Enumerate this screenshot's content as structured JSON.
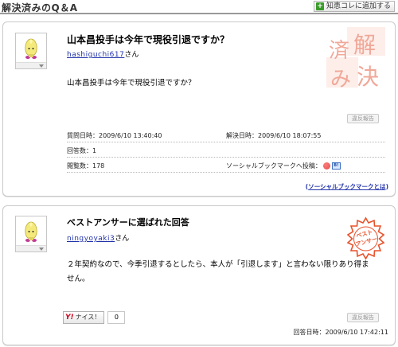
{
  "header": {
    "title": "解決済みのQ＆A",
    "add_button_label": "知恵コレに追加する"
  },
  "question": {
    "title": "山本昌投手は今年で現役引退ですか？",
    "asker": "hashiguchi617",
    "asker_suffix": "さん",
    "body": "山本昌投手は今年で現役引退ですか？",
    "report_label": "違反報告",
    "asked_label": "質問日時：2009/6/10 13:40:40",
    "resolved_label": "解決日時：2009/6/10 18:07:55",
    "answers_label": "回答数：1",
    "views_label": "閲覧数：178",
    "bookmark_label": "ソーシャルブックマークへ投稿：",
    "bookmark_help": "ソーシャルブックマークとは",
    "stamp_text": "解決済み"
  },
  "best_answer": {
    "heading": "ベストアンサーに選ばれた回答",
    "answerer": "ningyoyaki3",
    "answerer_suffix": "さん",
    "body": "２年契約なので、今季引退するとしたら、本人が「引退します」と言わない限りあり得ません。",
    "report_label": "違反報告",
    "nice_label": "ナイス！",
    "nice_count": "0",
    "answered_label": "回答日時：2009/6/10 17:42:11",
    "stamp_text": "ベストアンサー"
  },
  "colors": {
    "stamp_resolved": "#f1b3a8",
    "stamp_best": "#e8512a",
    "link": "#2233aa"
  }
}
